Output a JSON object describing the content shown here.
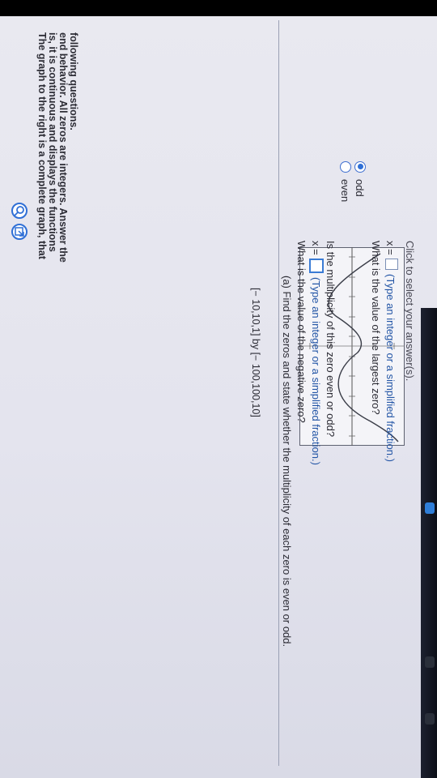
{
  "intro": {
    "lines": [
      "The graph to the right is a complete graph, that",
      "is, it is continuous and displays the functions",
      "end behavior. All zeros are integers. Answer the",
      "following questions."
    ]
  },
  "graph": {
    "window_caption": "[− 10,10,1] by [− 100,100,10]"
  },
  "part_a": {
    "heading": "(a) Find the zeros and state whether the multiplicity of each zero is even or odd.",
    "q1": {
      "question": "What is the value of the negative zero?",
      "prefix": "x =",
      "hint": "(Type an integer or a simplified fraction.)"
    },
    "q2": {
      "question": "Is the multiplicity of this zero even or odd?",
      "options": [
        {
          "label": "even",
          "selected": false
        },
        {
          "label": "odd",
          "selected": true
        }
      ]
    },
    "q3": {
      "question": "What is the value of the largest zero?",
      "prefix": "x =",
      "hint": "(Type an integer or a simplified fraction.)"
    }
  },
  "footer": {
    "text": "Click to select your answer(s)."
  },
  "tools": [
    "magnify-icon",
    "popout-icon"
  ],
  "colors": {
    "accent": "#2f6fd6",
    "text": "#2c2c35",
    "background": "#e7e7ef"
  }
}
